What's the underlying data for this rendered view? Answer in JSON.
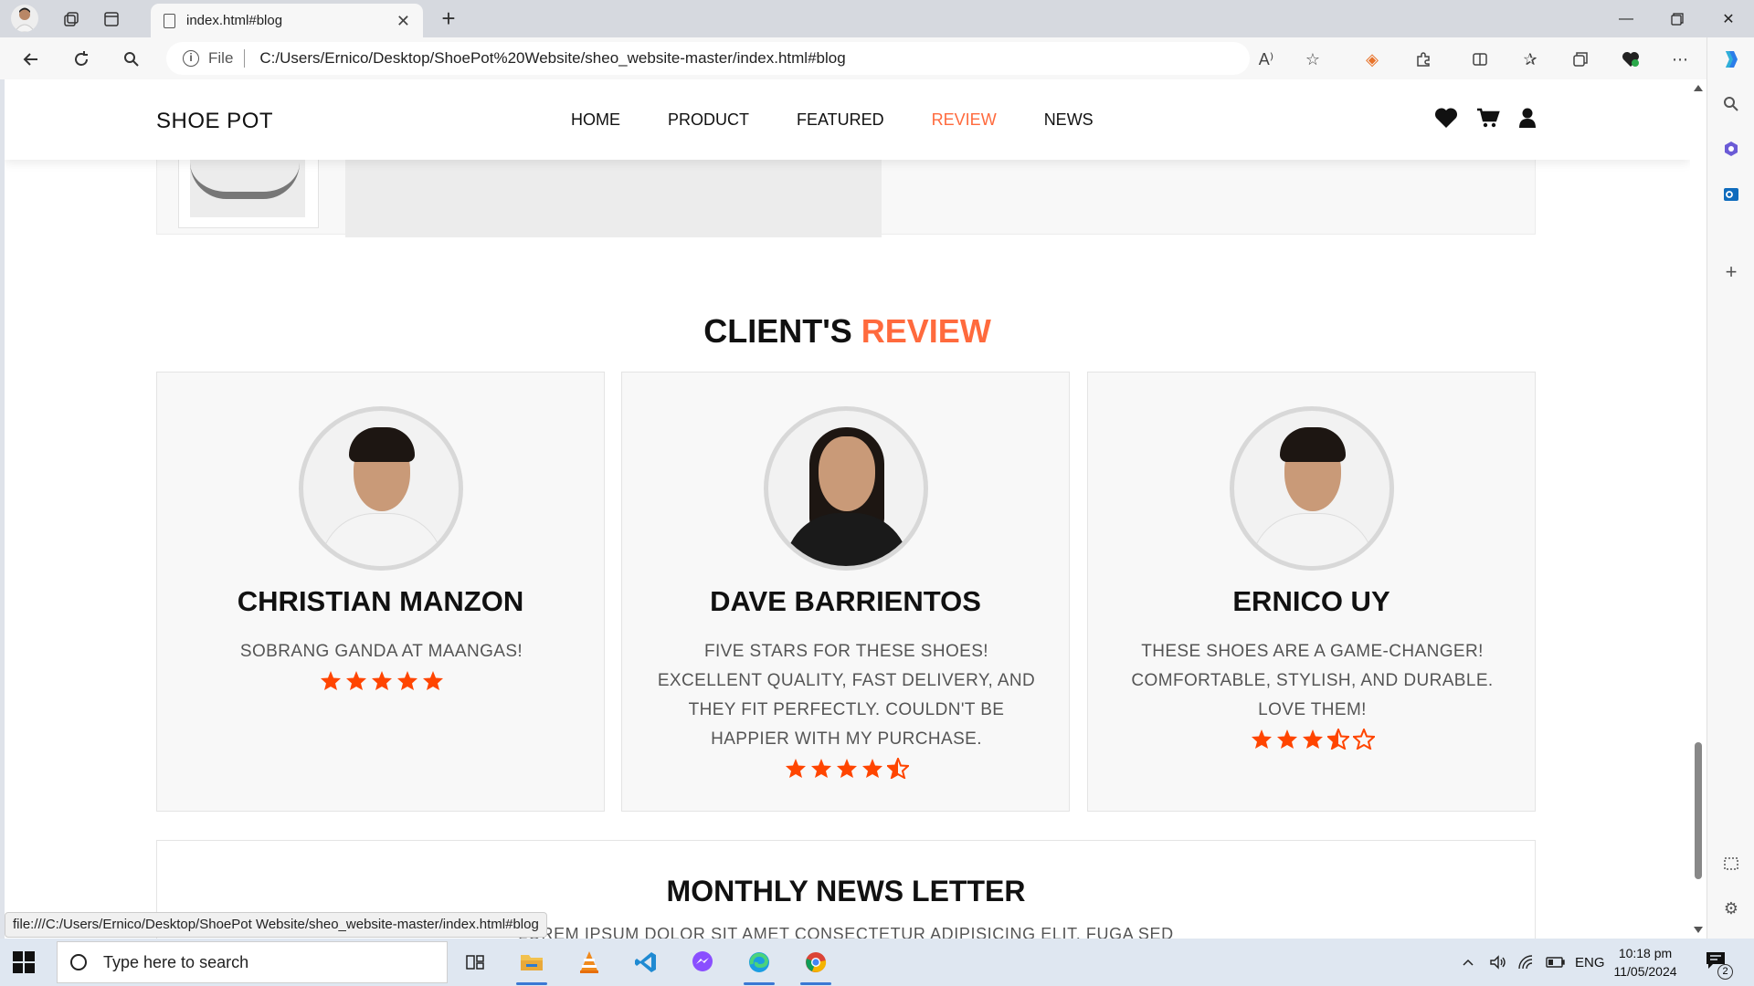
{
  "browser": {
    "tab_title": "index.html#blog",
    "address_prefix": "File",
    "url": "C:/Users/Ernico/Desktop/ShoePot%20Website/sheo_website-master/index.html#blog",
    "status_url": "file:///C:/Users/Ernico/Desktop/ShoePot Website/sheo_website-master/index.html#blog"
  },
  "site": {
    "logo": "SHOE POT",
    "nav": [
      {
        "label": "HOME",
        "active": false
      },
      {
        "label": "PRODUCT",
        "active": false
      },
      {
        "label": "FEATURED",
        "active": false
      },
      {
        "label": "REVIEW",
        "active": true
      },
      {
        "label": "NEWS",
        "active": false
      }
    ],
    "header_icons": [
      "heart-icon",
      "cart-icon",
      "user-icon"
    ]
  },
  "reviews": {
    "title_main": "CLIENT'S",
    "title_accent": "REVIEW",
    "items": [
      {
        "name": "CHRISTIAN MANZON",
        "text": "SOBRANG GANDA AT MAANGAS!",
        "rating": 5
      },
      {
        "name": "DAVE BARRIENTOS",
        "text": "FIVE STARS FOR THESE SHOES! EXCELLENT QUALITY, FAST DELIVERY, AND THEY FIT PERFECTLY. COULDN'T BE HAPPIER WITH MY PURCHASE.",
        "rating": 4.5
      },
      {
        "name": "ERNICO UY",
        "text": "THESE SHOES ARE A GAME-CHANGER! COMFORTABLE, STYLISH, AND DURABLE. LOVE THEM!",
        "rating": 3.5
      }
    ]
  },
  "newsletter": {
    "title": "MONTHLY NEWS LETTER",
    "subtitle": "LOREM IPSUM DOLOR SIT AMET CONSECTETUR ADIPISICING ELIT. FUGA SED"
  },
  "taskbar": {
    "search_placeholder": "Type here to search",
    "language": "ENG",
    "time": "10:18 pm",
    "date": "11/05/2024",
    "notification_count": "2"
  },
  "colors": {
    "accent": "#ff6a3d",
    "star": "#ff4500"
  }
}
